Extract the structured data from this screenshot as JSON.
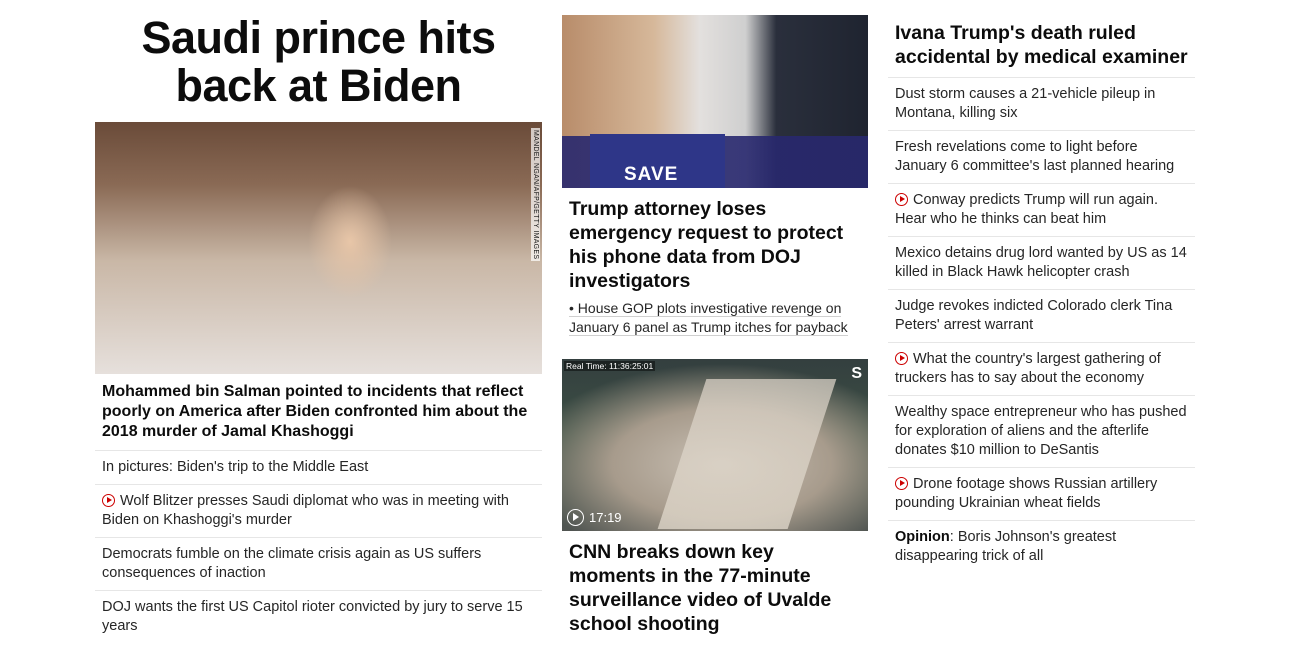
{
  "col1": {
    "headline": "Saudi prince hits back at Biden",
    "photo_credit": "MANDEL NGAN/AFP/GETTY IMAGES",
    "lead": "Mohammed bin Salman pointed to incidents that reflect poorly on America after Biden confronted him about the 2018 murder of Jamal Khashoggi",
    "items": [
      {
        "text": "In pictures: Biden's trip to the Middle East",
        "video": false
      },
      {
        "text": "Wolf Blitzer presses Saudi diplomat who was in meeting with Biden on Khashoggi's murder",
        "video": true
      },
      {
        "text": "Democrats fumble on the climate crisis again as US suffers consequences of inaction",
        "video": false
      },
      {
        "text": "DOJ wants the first US Capitol rioter convicted by jury to serve 15 years",
        "video": false
      }
    ]
  },
  "col2": {
    "story1": {
      "sign_text": "SAVE",
      "headline": "Trump attorney loses emergency request to protect his phone data from DOJ investigators",
      "sub": "• House GOP plots investigative revenge on January 6 panel as Trump itches for payback"
    },
    "story2": {
      "cam_timestamp": "Real Time: 11:36:25:01",
      "duration": "17:19",
      "headline": "CNN breaks down key moments in the 77-minute surveillance video of Uvalde school shooting"
    }
  },
  "col3": {
    "headline": "Ivana Trump's death ruled accidental by medical examiner",
    "items": [
      {
        "text": "Dust storm causes a 21-vehicle pileup in Montana, killing six",
        "video": false
      },
      {
        "text": "Fresh revelations come to light before January 6 committee's last planned hearing",
        "video": false
      },
      {
        "text": "Conway predicts Trump will run again. Hear who he thinks can beat him",
        "video": true
      },
      {
        "text": "Mexico detains drug lord wanted by US as 14 killed in Black Hawk helicopter crash",
        "video": false
      },
      {
        "text": "Judge revokes indicted Colorado clerk Tina Peters' arrest warrant",
        "video": false
      },
      {
        "text": "What the country's largest gathering of truckers has to say about the economy",
        "video": true
      },
      {
        "text": "Wealthy space entrepreneur who has pushed for exploration of aliens and the afterlife donates $10 million to DeSantis",
        "video": false
      },
      {
        "text": "Drone footage shows Russian artillery pounding Ukrainian wheat fields",
        "video": true
      }
    ],
    "opinion_label": "Opinion",
    "opinion_text": ": Boris Johnson's greatest disappearing trick of all"
  },
  "colors": {
    "accent_red": "#cc0000",
    "text": "#0c0c0c",
    "divider": "#e6e6e6"
  }
}
